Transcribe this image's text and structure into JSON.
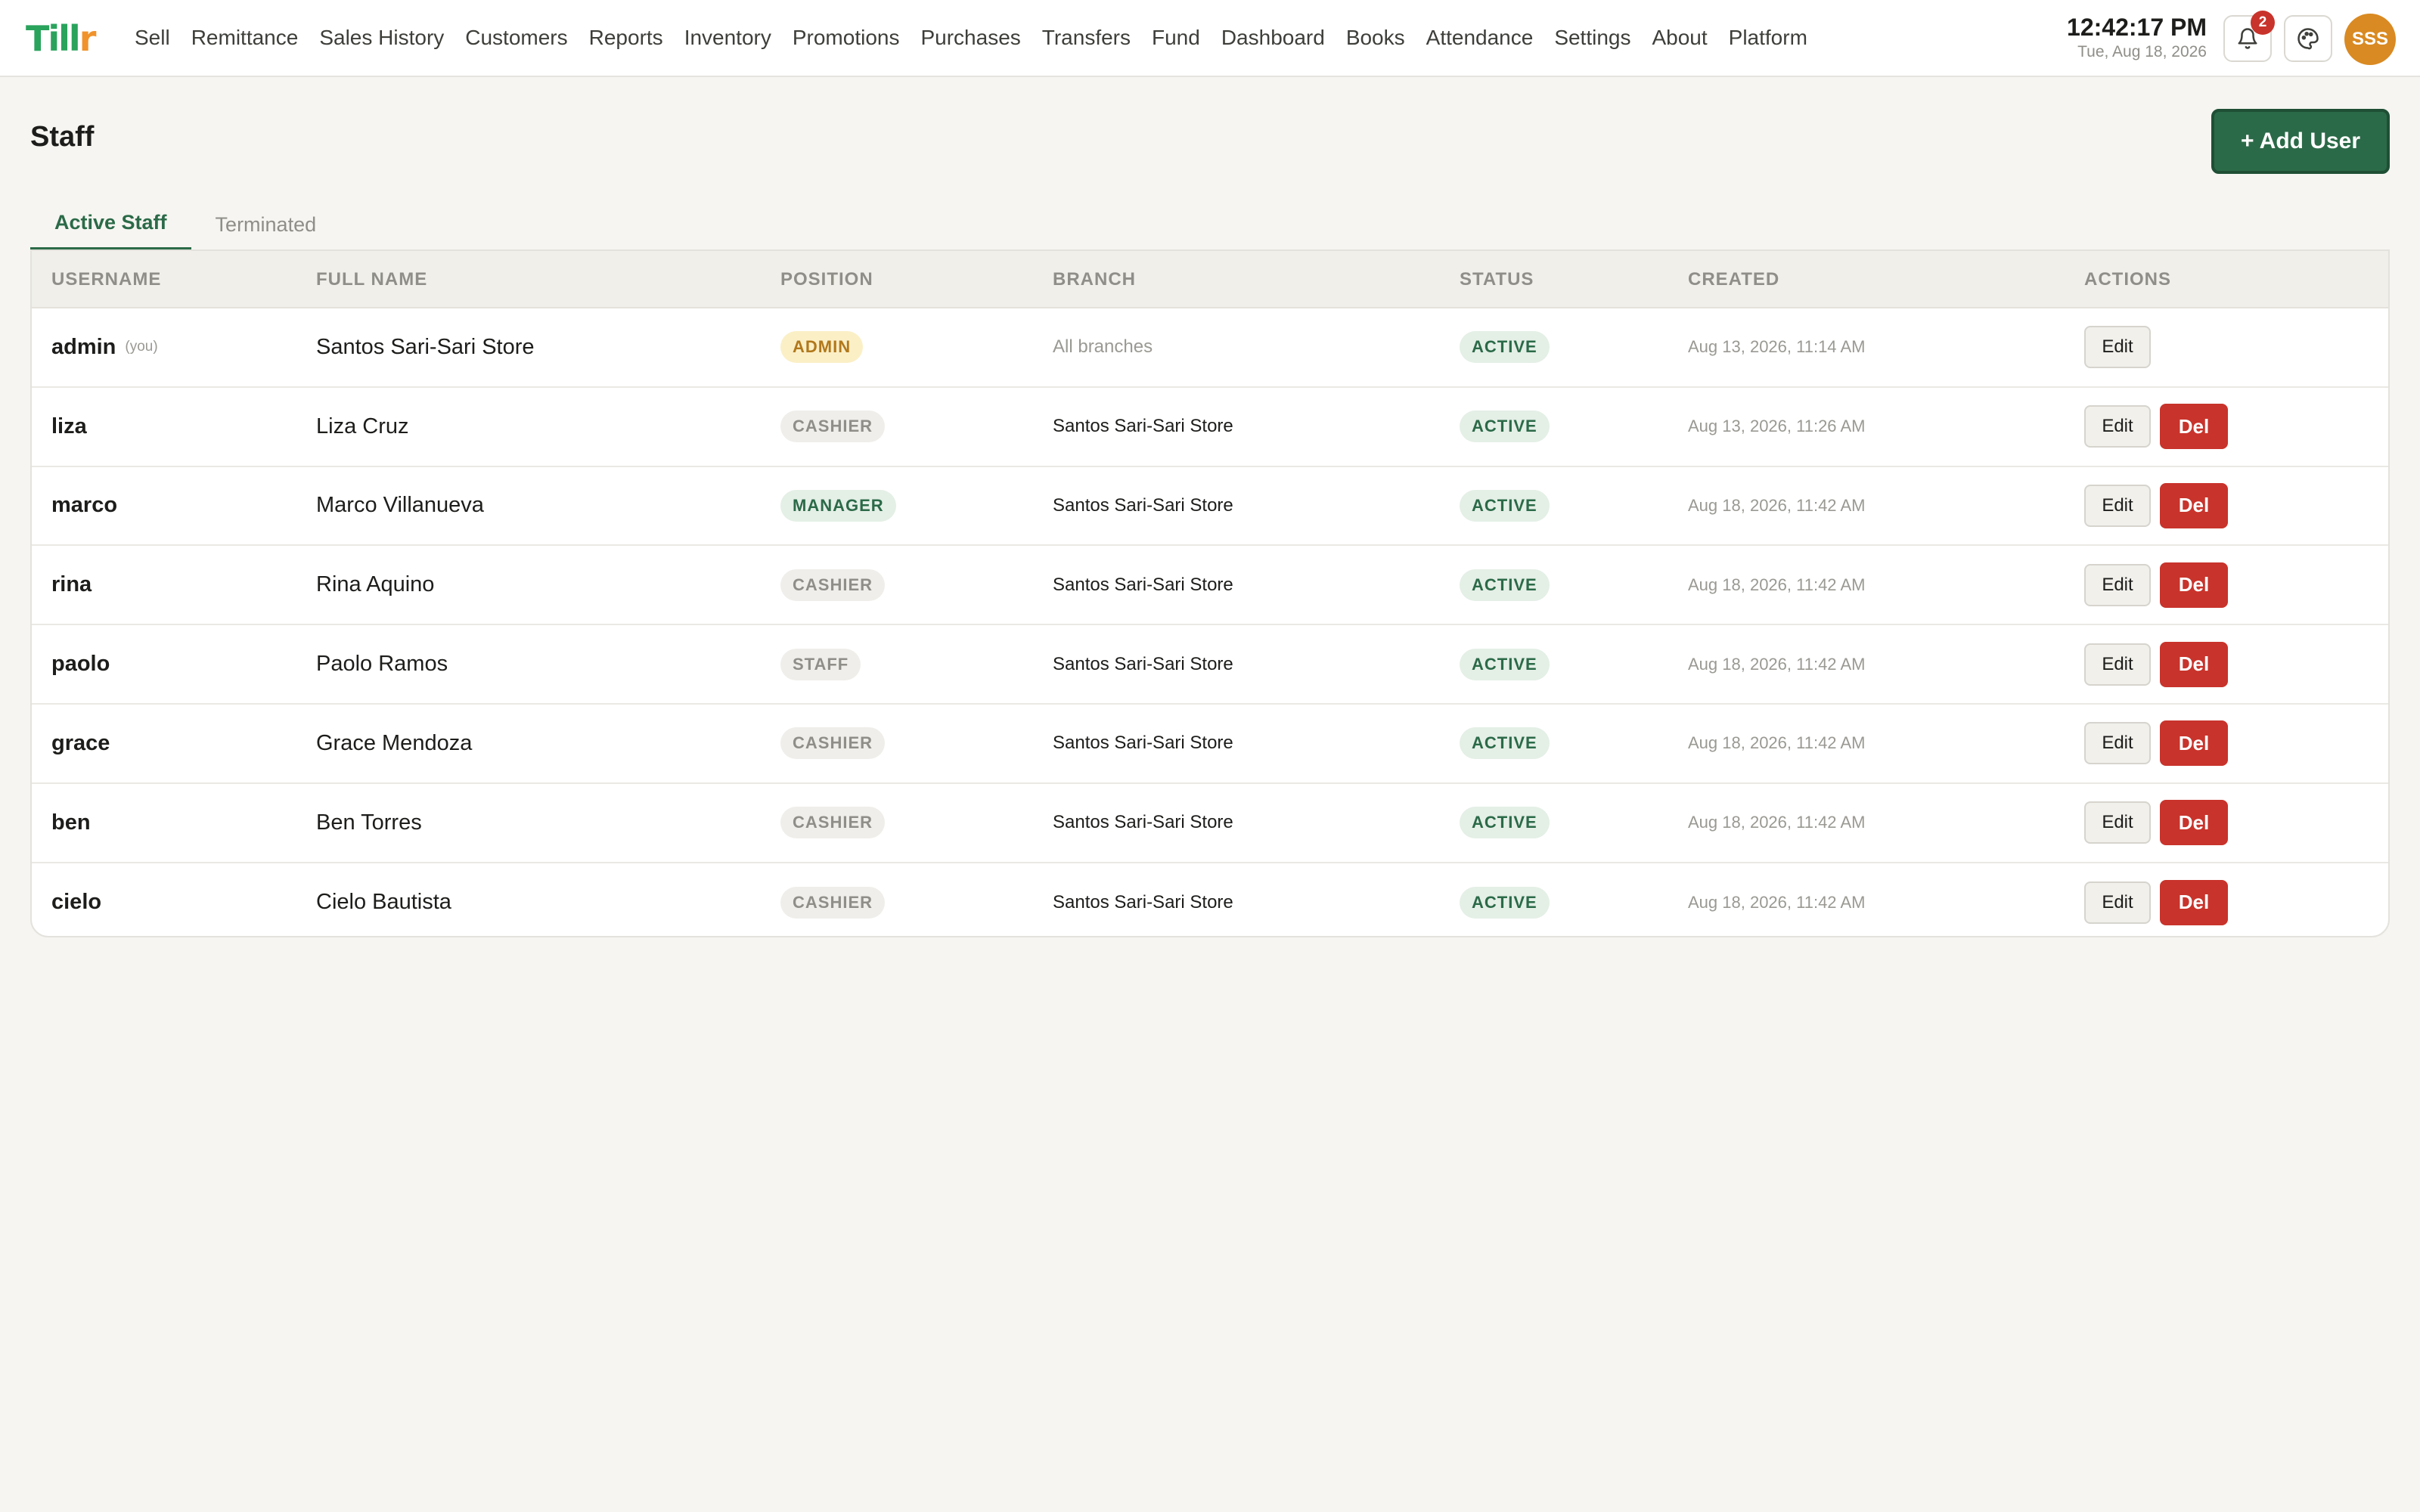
{
  "app": {
    "logo_main": "Till",
    "logo_accent": "r",
    "nav": [
      "Sell",
      "Remittance",
      "Sales History",
      "Customers",
      "Reports",
      "Inventory",
      "Promotions",
      "Purchases",
      "Transfers",
      "Fund",
      "Dashboard",
      "Books",
      "Attendance",
      "Settings",
      "About",
      "Platform"
    ],
    "clock_time": "12:42:17 PM",
    "clock_date": "Tue, Aug 18, 2026",
    "notification_count": "2",
    "avatar_initials": "SSS",
    "icons": {
      "bell": "bell-icon",
      "palette": "palette-icon"
    }
  },
  "page": {
    "title": "Staff",
    "add_button": "+ Add User",
    "tabs": [
      {
        "label": "Active Staff",
        "active": true
      },
      {
        "label": "Terminated",
        "active": false
      }
    ]
  },
  "table": {
    "columns": [
      "USERNAME",
      "FULL NAME",
      "POSITION",
      "BRANCH",
      "STATUS",
      "CREATED",
      "ACTIONS"
    ],
    "edit_label": "Edit",
    "del_label": "Del",
    "rows": [
      {
        "username": "admin",
        "you": "(you)",
        "full_name": "Santos Sari-Sari Store",
        "position": "ADMIN",
        "branch": "All branches",
        "status": "ACTIVE",
        "created": "Aug 13, 2026, 11:14 AM",
        "deletable": false
      },
      {
        "username": "liza",
        "you": "",
        "full_name": "Liza Cruz",
        "position": "CASHIER",
        "branch": "Santos Sari-Sari Store",
        "status": "ACTIVE",
        "created": "Aug 13, 2026, 11:26 AM",
        "deletable": true
      },
      {
        "username": "marco",
        "you": "",
        "full_name": "Marco Villanueva",
        "position": "MANAGER",
        "branch": "Santos Sari-Sari Store",
        "status": "ACTIVE",
        "created": "Aug 18, 2026, 11:42 AM",
        "deletable": true
      },
      {
        "username": "rina",
        "you": "",
        "full_name": "Rina Aquino",
        "position": "CASHIER",
        "branch": "Santos Sari-Sari Store",
        "status": "ACTIVE",
        "created": "Aug 18, 2026, 11:42 AM",
        "deletable": true
      },
      {
        "username": "paolo",
        "you": "",
        "full_name": "Paolo Ramos",
        "position": "STAFF",
        "branch": "Santos Sari-Sari Store",
        "status": "ACTIVE",
        "created": "Aug 18, 2026, 11:42 AM",
        "deletable": true
      },
      {
        "username": "grace",
        "you": "",
        "full_name": "Grace Mendoza",
        "position": "CASHIER",
        "branch": "Santos Sari-Sari Store",
        "status": "ACTIVE",
        "created": "Aug 18, 2026, 11:42 AM",
        "deletable": true
      },
      {
        "username": "ben",
        "you": "",
        "full_name": "Ben Torres",
        "position": "CASHIER",
        "branch": "Santos Sari-Sari Store",
        "status": "ACTIVE",
        "created": "Aug 18, 2026, 11:42 AM",
        "deletable": true
      },
      {
        "username": "cielo",
        "you": "",
        "full_name": "Cielo Bautista",
        "position": "CASHIER",
        "branch": "Santos Sari-Sari Store",
        "status": "ACTIVE",
        "created": "Aug 18, 2026, 11:42 AM",
        "deletable": true
      }
    ]
  },
  "colors": {
    "brand_green": "#2b6a48",
    "logo_green": "#2aa35c",
    "logo_orange": "#f0932b",
    "danger": "#c8332b",
    "avatar": "#d98a22"
  }
}
